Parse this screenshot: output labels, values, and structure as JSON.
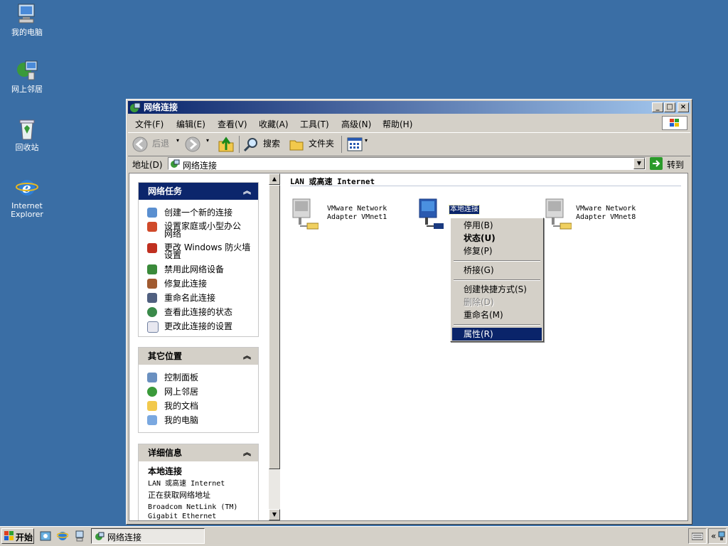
{
  "desktop": {
    "icons": [
      {
        "label": "我的电脑",
        "icon": "my-computer-icon"
      },
      {
        "label": "网上邻居",
        "icon": "network-places-icon"
      },
      {
        "label": "回收站",
        "icon": "recycle-bin-icon"
      },
      {
        "label_line1": "Internet",
        "label_line2": "Explorer",
        "icon": "ie-icon"
      }
    ]
  },
  "window": {
    "title": "网络连接",
    "menu": [
      "文件(F)",
      "编辑(E)",
      "查看(V)",
      "收藏(A)",
      "工具(T)",
      "高级(N)",
      "帮助(H)"
    ],
    "toolbar": {
      "back": "后退",
      "search": "搜索",
      "folders": "文件夹"
    },
    "address": {
      "label": "地址(D)",
      "value": "网络连接",
      "go": "转到"
    }
  },
  "tasks": {
    "network_tasks": {
      "title": "网络任务",
      "items": [
        {
          "label": "创建一个新的连接"
        },
        {
          "label_line1": "设置家庭或小型办公",
          "label_line2": "网络"
        },
        {
          "label_line1": "更改 Windows 防火墙",
          "label_line2": "设置"
        },
        {
          "label": "禁用此网络设备"
        },
        {
          "label": "修复此连接"
        },
        {
          "label": "重命名此连接"
        },
        {
          "label": "查看此连接的状态"
        },
        {
          "label": "更改此连接的设置"
        }
      ]
    },
    "other_places": {
      "title": "其它位置",
      "items": [
        "控制面板",
        "网上邻居",
        "我的文档",
        "我的电脑"
      ]
    },
    "details": {
      "title": "详细信息",
      "name": "本地连接",
      "type": "LAN 或高速 Internet",
      "status": "正在获取网络地址",
      "device_line1": "Broadcom NetLink (TM)",
      "device_line2": "Gigabit Ethernet"
    }
  },
  "main": {
    "group_header": "LAN 或高速 Internet",
    "adapters": [
      {
        "line1": "VMware Network",
        "line2": "Adapter VMnet1"
      },
      {
        "line1": "本地连接",
        "line2": ""
      },
      {
        "line1": "VMware Network",
        "line2": "Adapter VMnet8"
      }
    ]
  },
  "context_menu": {
    "items": [
      "停用(B)",
      "状态(U)",
      "修复(P)",
      "桥接(G)",
      "创建快捷方式(S)",
      "删除(D)",
      "重命名(M)",
      "属性(R)"
    ]
  },
  "taskbar": {
    "start": "开始",
    "task": "网络连接"
  },
  "colors": {
    "desktop": "#3a6ea5",
    "title_start": "#0a246a",
    "title_end": "#a6caf0",
    "panel_header_blue": "#0c266c",
    "selection": "#0a246a"
  }
}
